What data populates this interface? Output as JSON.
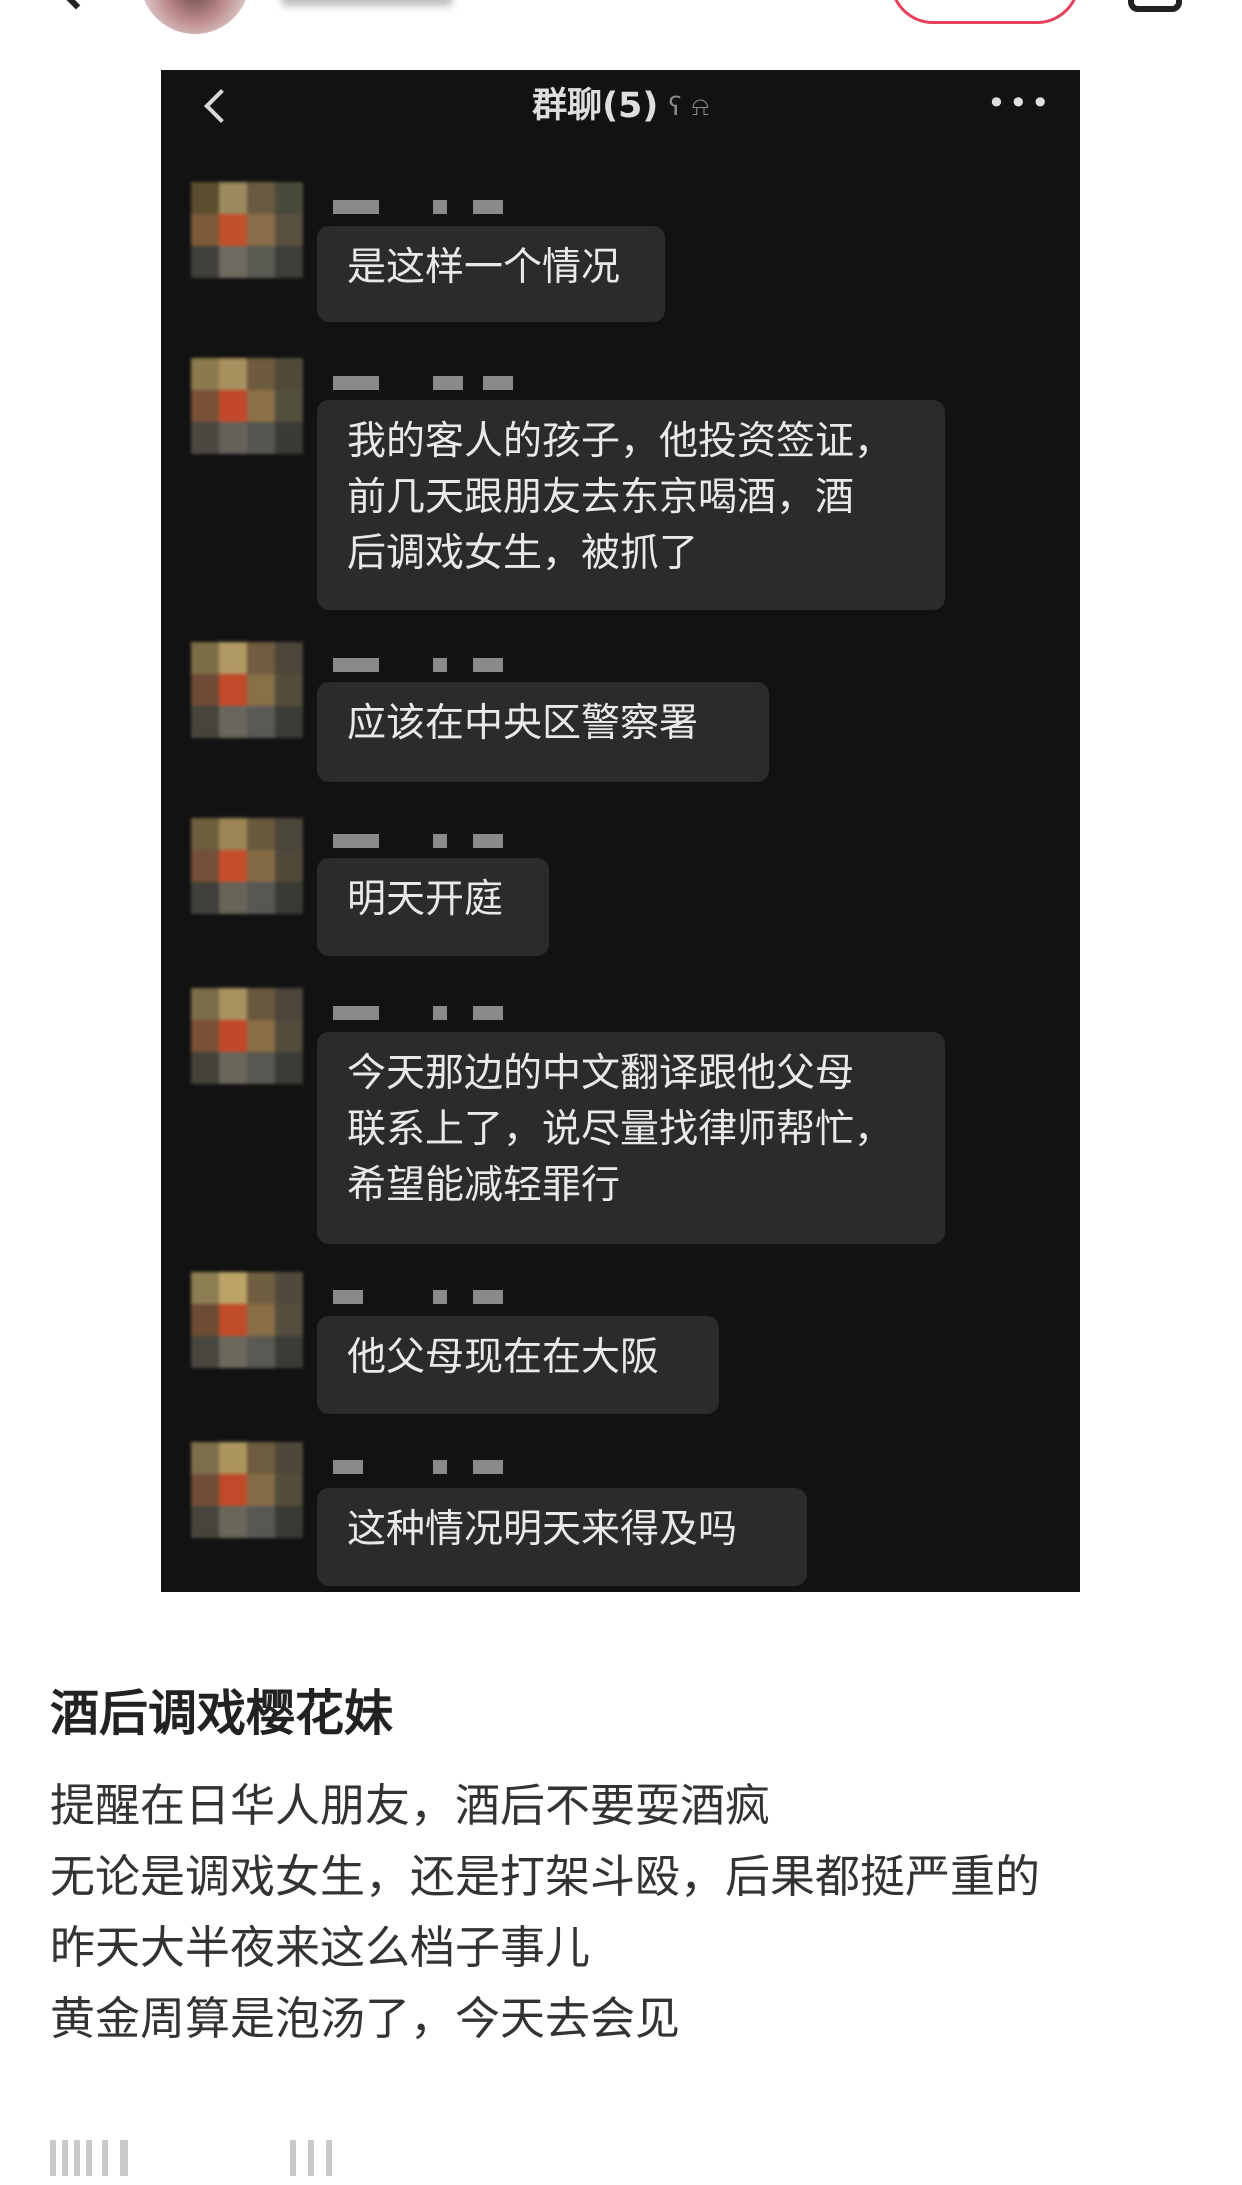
{
  "post": {
    "title": "酒后调戏樱花妹",
    "body_lines": [
      "提醒在日华人朋友，酒后不要耍酒疯",
      "无论是调戏女生，还是打架斗殴，后果都挺严重的",
      "昨天大半夜来这么档子事儿",
      "黄金周算是泡汤了，今天去会见"
    ]
  },
  "chat": {
    "title": "群聊(5)",
    "icons": {
      "back": "chevron-left-icon",
      "ear": "ear-icon",
      "mute": "bell-muted-icon",
      "more": "more-icon"
    },
    "messages": [
      {
        "text": "是这样一个情况"
      },
      {
        "text": "我的客人的孩子，他投资签证，\n前几天跟朋友去东京喝酒，酒\n后调戏女生，被抓了"
      },
      {
        "text": "应该在中央区警察署"
      },
      {
        "text": "明天开庭"
      },
      {
        "text": "今天那边的中文翻译跟他父母\n联系上了，说尽量找律师帮忙，\n希望能减轻罪行"
      },
      {
        "text": "他父母现在在大阪"
      },
      {
        "text": "这种情况明天来得及吗"
      }
    ]
  },
  "colors": {
    "chat_bg": "#121212",
    "bubble_bg": "#2b2b2b",
    "bubble_text": "#e9e9e9",
    "follow_accent": "#e8405a"
  }
}
